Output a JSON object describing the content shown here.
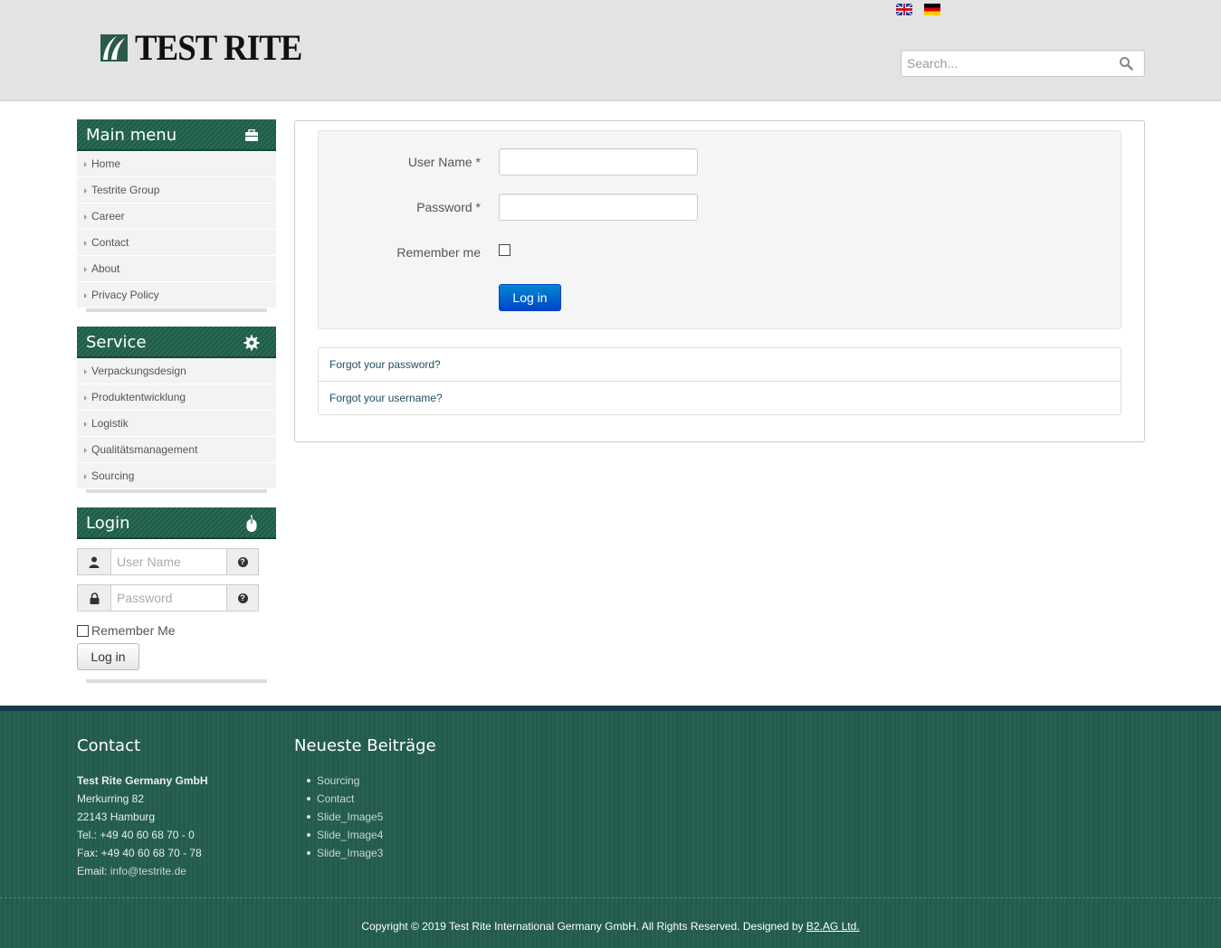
{
  "header": {
    "logo_text": "TEST RITE",
    "languages": [
      {
        "name": "English",
        "icon": "uk-flag-icon"
      },
      {
        "name": "Deutsch",
        "icon": "de-flag-icon"
      }
    ],
    "search_placeholder": "Search..."
  },
  "main_menu": {
    "title": "Main menu",
    "icon": "briefcase-icon",
    "items": [
      "Home",
      "Testrite Group",
      "Career",
      "Contact",
      "About",
      "Privacy Policy"
    ]
  },
  "service": {
    "title": "Service",
    "icon": "gear-icon",
    "items": [
      "Verpackungsdesign",
      "Produktentwicklung",
      "Logistik",
      "Qualitätsmanagement",
      "Sourcing"
    ]
  },
  "sidebar_login": {
    "title": "Login",
    "icon": "mouse-icon",
    "username_placeholder": "User Name",
    "password_placeholder": "Password",
    "remember_label": "Remember Me",
    "button_label": "Log in"
  },
  "login_form": {
    "username_label": "User Name *",
    "password_label": "Password *",
    "remember_label": "Remember me",
    "button_label": "Log in",
    "links": [
      "Forgot your password?",
      "Forgot your username?"
    ]
  },
  "footer": {
    "contact_title": "Contact",
    "company": "Test Rite Germany GmbH",
    "street": "Merkurring 82",
    "city": "22143 Hamburg",
    "tel": "Tel.: +49 40 60 68 70 - 0",
    "fax": "Fax: +49 40 60 68 70 - 78",
    "email_label": "Email: ",
    "email": "info@testrite.de",
    "posts_title": "Neueste Beiträge",
    "posts": [
      "Sourcing",
      "Contact",
      "Slide_Image5",
      "Slide_Image4",
      "Slide_Image3"
    ],
    "copyright": "Copyright © 2019 Test Rite International Germany GmbH. All Rights Reserved. Designed by ",
    "designer": "B2.AG Ltd."
  },
  "colors": {
    "brand_green": "#245e50",
    "primary_blue": "#0088cc",
    "footer_border": "#173a4a"
  }
}
